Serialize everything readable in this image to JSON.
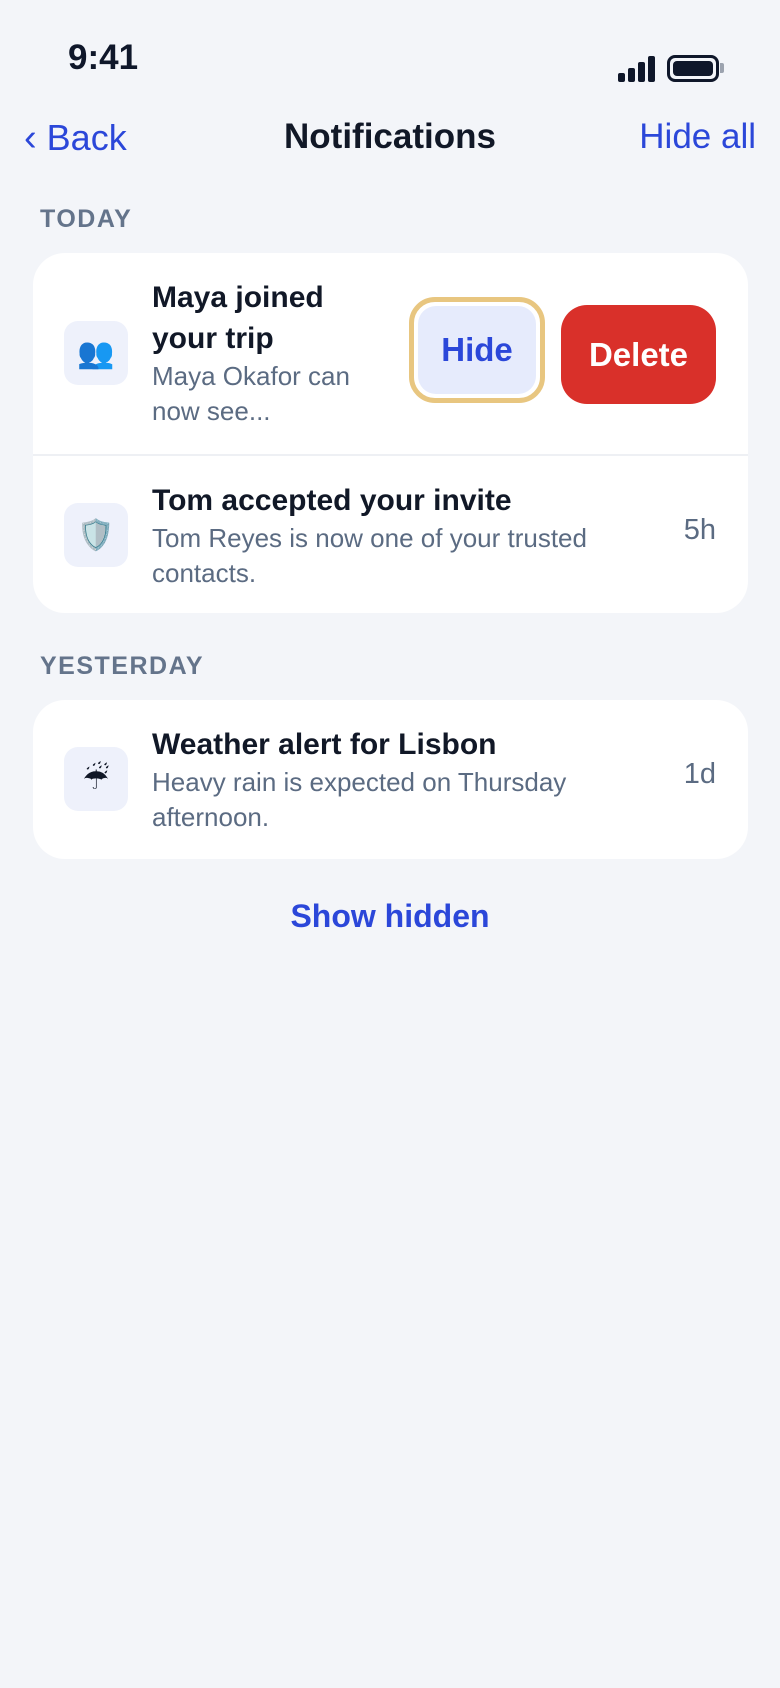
{
  "status_bar": {
    "time": "9:41"
  },
  "nav": {
    "back_label": "Back",
    "back_chevron": "‹",
    "title": "Notifications",
    "action_label": "Hide all"
  },
  "sections": [
    {
      "header": "TODAY",
      "items": [
        {
          "icon": "👥",
          "icon_name": "people-icon",
          "title": "Maya joined your trip",
          "title_lines": [
            "Maya joined",
            "your trip"
          ],
          "body_lines": [
            "Maya Okafor can",
            "now see..."
          ],
          "swiped": true,
          "actions": {
            "hide": "Hide",
            "delete": "Delete"
          }
        },
        {
          "icon": "🛡️",
          "icon_name": "shield-icon",
          "title": "Tom accepted your invite",
          "body_lines": [
            "Tom Reyes is now one of your trusted",
            "contacts."
          ],
          "time": "5h"
        }
      ]
    },
    {
      "header": "YESTERDAY",
      "items": [
        {
          "icon": "☔",
          "icon_name": "umbrella-rain-icon",
          "title": "Weather alert for Lisbon",
          "body_lines": [
            "Heavy rain is expected on Thursday",
            "afternoon."
          ],
          "time": "1d"
        }
      ]
    }
  ],
  "footer": {
    "show_hidden_label": "Show hidden"
  },
  "colors": {
    "accent": "#2b47d9",
    "danger": "#d9302a",
    "focus_ring": "#e8c680",
    "background": "#f3f5f9",
    "muted_text": "#5b6b82"
  }
}
